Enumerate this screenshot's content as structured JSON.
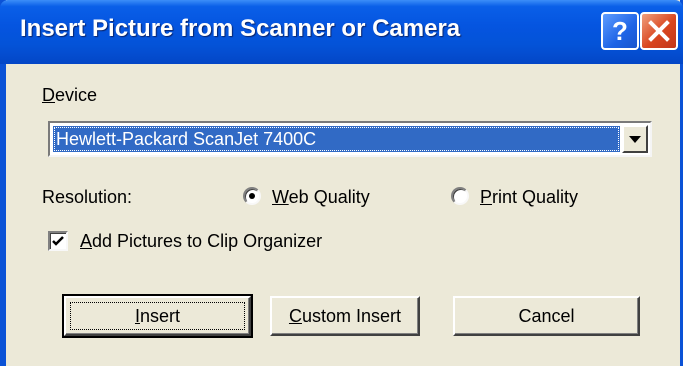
{
  "window": {
    "title": "Insert Picture from Scanner or Camera"
  },
  "titlebar_buttons": {
    "help": "?",
    "close_icon": "close-x"
  },
  "device": {
    "label_mnemonic": "D",
    "label_rest": "evice",
    "selected": "Hewlett-Packard ScanJet 7400C"
  },
  "resolution": {
    "label": "Resolution:",
    "options": [
      {
        "mnemonic": "W",
        "rest": "eb Quality",
        "selected": true
      },
      {
        "mnemonic": "P",
        "rest": "rint Quality",
        "selected": false
      }
    ]
  },
  "clip_organizer": {
    "mnemonic": "A",
    "rest": "dd Pictures to Clip Organizer",
    "checked": true
  },
  "buttons": {
    "insert": {
      "mnemonic": "I",
      "rest": "nsert"
    },
    "custom_insert": {
      "mnemonic": "C",
      "rest": "ustom Insert"
    },
    "cancel": "Cancel"
  },
  "colors": {
    "titlebar": "#0453d8",
    "selection": "#316ac5",
    "close": "#d9461f",
    "dialog": "#ece9d8"
  }
}
